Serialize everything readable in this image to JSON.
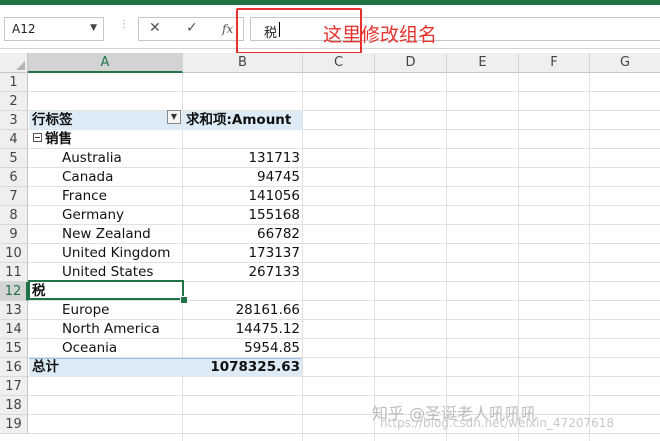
{
  "name_box": {
    "value": "A12",
    "caret": "▼"
  },
  "formula_bar": {
    "cancel_icon": "✕",
    "enter_icon": "✓",
    "fx_label": "fx",
    "content": "税"
  },
  "annotation": {
    "text": "这里修改组名",
    "color": "#e5322d"
  },
  "columns": [
    "A",
    "B",
    "C",
    "D",
    "E",
    "F",
    "G"
  ],
  "rows": [
    "1",
    "2",
    "3",
    "4",
    "5",
    "6",
    "7",
    "8",
    "9",
    "10",
    "11",
    "12",
    "13",
    "14",
    "15",
    "16",
    "17",
    "18",
    "19"
  ],
  "pivot": {
    "header_label": "行标签",
    "header_value": "求和项:Amount",
    "filter_icon": "▼",
    "group1": {
      "name": "销售",
      "items": [
        {
          "label": "Australia",
          "value": "131713"
        },
        {
          "label": "Canada",
          "value": "94745"
        },
        {
          "label": "France",
          "value": "141056"
        },
        {
          "label": "Germany",
          "value": "155168"
        },
        {
          "label": "New Zealand",
          "value": "66782"
        },
        {
          "label": "United Kingdom",
          "value": "173137"
        },
        {
          "label": "United States",
          "value": "267133"
        }
      ]
    },
    "group2": {
      "name": "税",
      "items": [
        {
          "label": "Europe",
          "value": "28161.66"
        },
        {
          "label": "North America",
          "value": "14475.12"
        },
        {
          "label": "Oceania",
          "value": "5954.85"
        }
      ]
    },
    "total_label": "总计",
    "total_value": "1078325.63"
  },
  "watermark": {
    "main": "知乎 @圣诞老人吼吼吼",
    "url": "https://blog.csdn.net/weixin_47207618"
  },
  "colors": {
    "excel_green": "#217346",
    "pivot_band": "#ddebf7"
  }
}
